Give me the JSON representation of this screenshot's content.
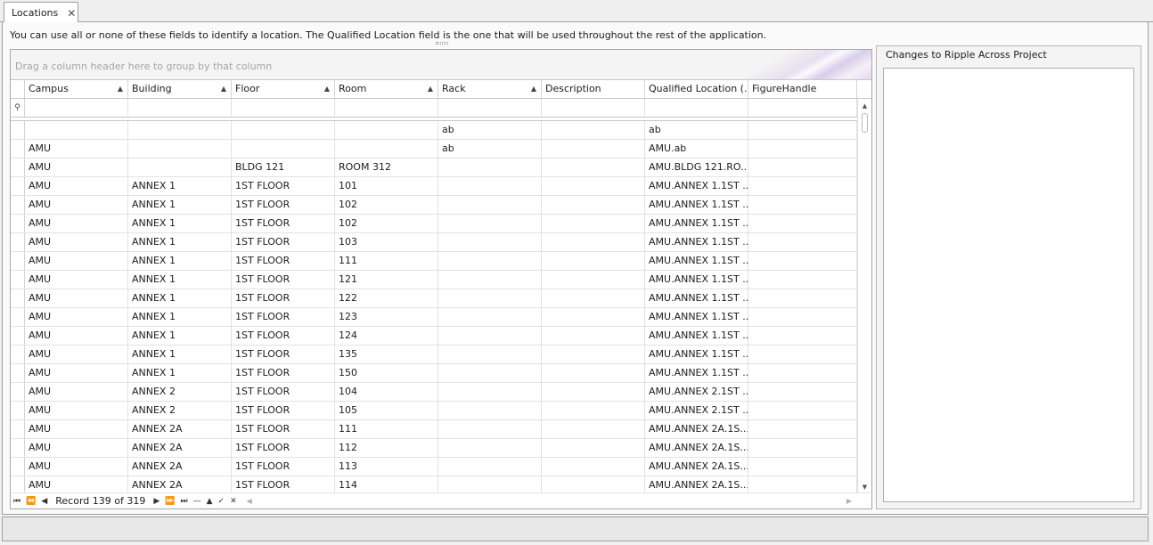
{
  "tab": {
    "label": "Locations",
    "close_glyph": "✕"
  },
  "info_text": "You can use all or none of these fields to identify a location. The Qualified Location field is the one that will be used throughout the rest of the application.",
  "grid": {
    "group_panel_text": "Drag a column header here to group by that column",
    "columns": [
      "Campus",
      "Building",
      "Floor",
      "Room",
      "Rack",
      "Description",
      "Qualified Location (...",
      "FigureHandle"
    ],
    "sorted_columns": [
      true,
      true,
      true,
      true,
      true,
      false,
      false,
      false
    ],
    "rows": [
      [
        "",
        "",
        "",
        "",
        "ab",
        "",
        "ab",
        ""
      ],
      [
        "AMU",
        "",
        "",
        "",
        "ab",
        "",
        "AMU.ab",
        ""
      ],
      [
        "AMU",
        "",
        "BLDG 121",
        "ROOM 312",
        "",
        "",
        "AMU.BLDG 121.RO...",
        ""
      ],
      [
        "AMU",
        "ANNEX  1",
        "1ST FLOOR",
        "101",
        "",
        "",
        "AMU.ANNEX  1.1ST ...",
        ""
      ],
      [
        "AMU",
        "ANNEX  1",
        "1ST FLOOR",
        "102",
        "",
        "",
        "AMU.ANNEX  1.1ST ...",
        ""
      ],
      [
        "AMU",
        "ANNEX  1",
        "1ST FLOOR",
        "102",
        "",
        "",
        "AMU.ANNEX  1.1ST ...",
        ""
      ],
      [
        "AMU",
        "ANNEX  1",
        "1ST FLOOR",
        "103",
        "",
        "",
        "AMU.ANNEX  1.1ST ...",
        ""
      ],
      [
        "AMU",
        "ANNEX  1",
        "1ST FLOOR",
        "111",
        "",
        "",
        "AMU.ANNEX  1.1ST ...",
        ""
      ],
      [
        "AMU",
        "ANNEX  1",
        "1ST FLOOR",
        "121",
        "",
        "",
        "AMU.ANNEX  1.1ST ...",
        ""
      ],
      [
        "AMU",
        "ANNEX  1",
        "1ST FLOOR",
        "122",
        "",
        "",
        "AMU.ANNEX  1.1ST ...",
        ""
      ],
      [
        "AMU",
        "ANNEX  1",
        "1ST FLOOR",
        "123",
        "",
        "",
        "AMU.ANNEX  1.1ST ...",
        ""
      ],
      [
        "AMU",
        "ANNEX  1",
        "1ST FLOOR",
        "124",
        "",
        "",
        "AMU.ANNEX  1.1ST ...",
        ""
      ],
      [
        "AMU",
        "ANNEX  1",
        "1ST FLOOR",
        "135",
        "",
        "",
        "AMU.ANNEX  1.1ST ...",
        ""
      ],
      [
        "AMU",
        "ANNEX  1",
        "1ST FLOOR",
        "150",
        "",
        "",
        "AMU.ANNEX  1.1ST ...",
        ""
      ],
      [
        "AMU",
        "ANNEX  2",
        "1ST FLOOR",
        "104",
        "",
        "",
        "AMU.ANNEX  2.1ST ...",
        ""
      ],
      [
        "AMU",
        "ANNEX  2",
        "1ST FLOOR",
        "105",
        "",
        "",
        "AMU.ANNEX  2.1ST ...",
        ""
      ],
      [
        "AMU",
        "ANNEX  2A",
        "1ST FLOOR",
        "111",
        "",
        "",
        "AMU.ANNEX  2A.1S...",
        ""
      ],
      [
        "AMU",
        "ANNEX  2A",
        "1ST FLOOR",
        "112",
        "",
        "",
        "AMU.ANNEX  2A.1S...",
        ""
      ],
      [
        "AMU",
        "ANNEX  2A",
        "1ST FLOOR",
        "113",
        "",
        "",
        "AMU.ANNEX  2A.1S...",
        ""
      ],
      [
        "AMU",
        "ANNEX  2A",
        "1ST FLOOR",
        "114",
        "",
        "",
        "AMU.ANNEX  2A.1S...",
        ""
      ]
    ],
    "navigator": {
      "first": "⏮",
      "prev_page": "⏪",
      "prev": "◀",
      "record_text": "Record 139 of 319",
      "next": "▶",
      "next_page": "⏩",
      "last": "⏭",
      "remove": "—",
      "up": "▲",
      "ok": "✓",
      "cancel": "✕"
    }
  },
  "changes_panel": {
    "title": "Changes to Ripple Across Project"
  },
  "icons": {
    "close": "close-icon",
    "sort_asc": "sort-ascending-icon",
    "filter": "filter-pin-icon",
    "scroll_up": "scroll-up-icon",
    "scroll_down": "scroll-down-icon"
  },
  "colors": {
    "tab_bg": "#ffffff",
    "grid_border": "#a8a8a8",
    "group_text": "#a5a5a5"
  }
}
